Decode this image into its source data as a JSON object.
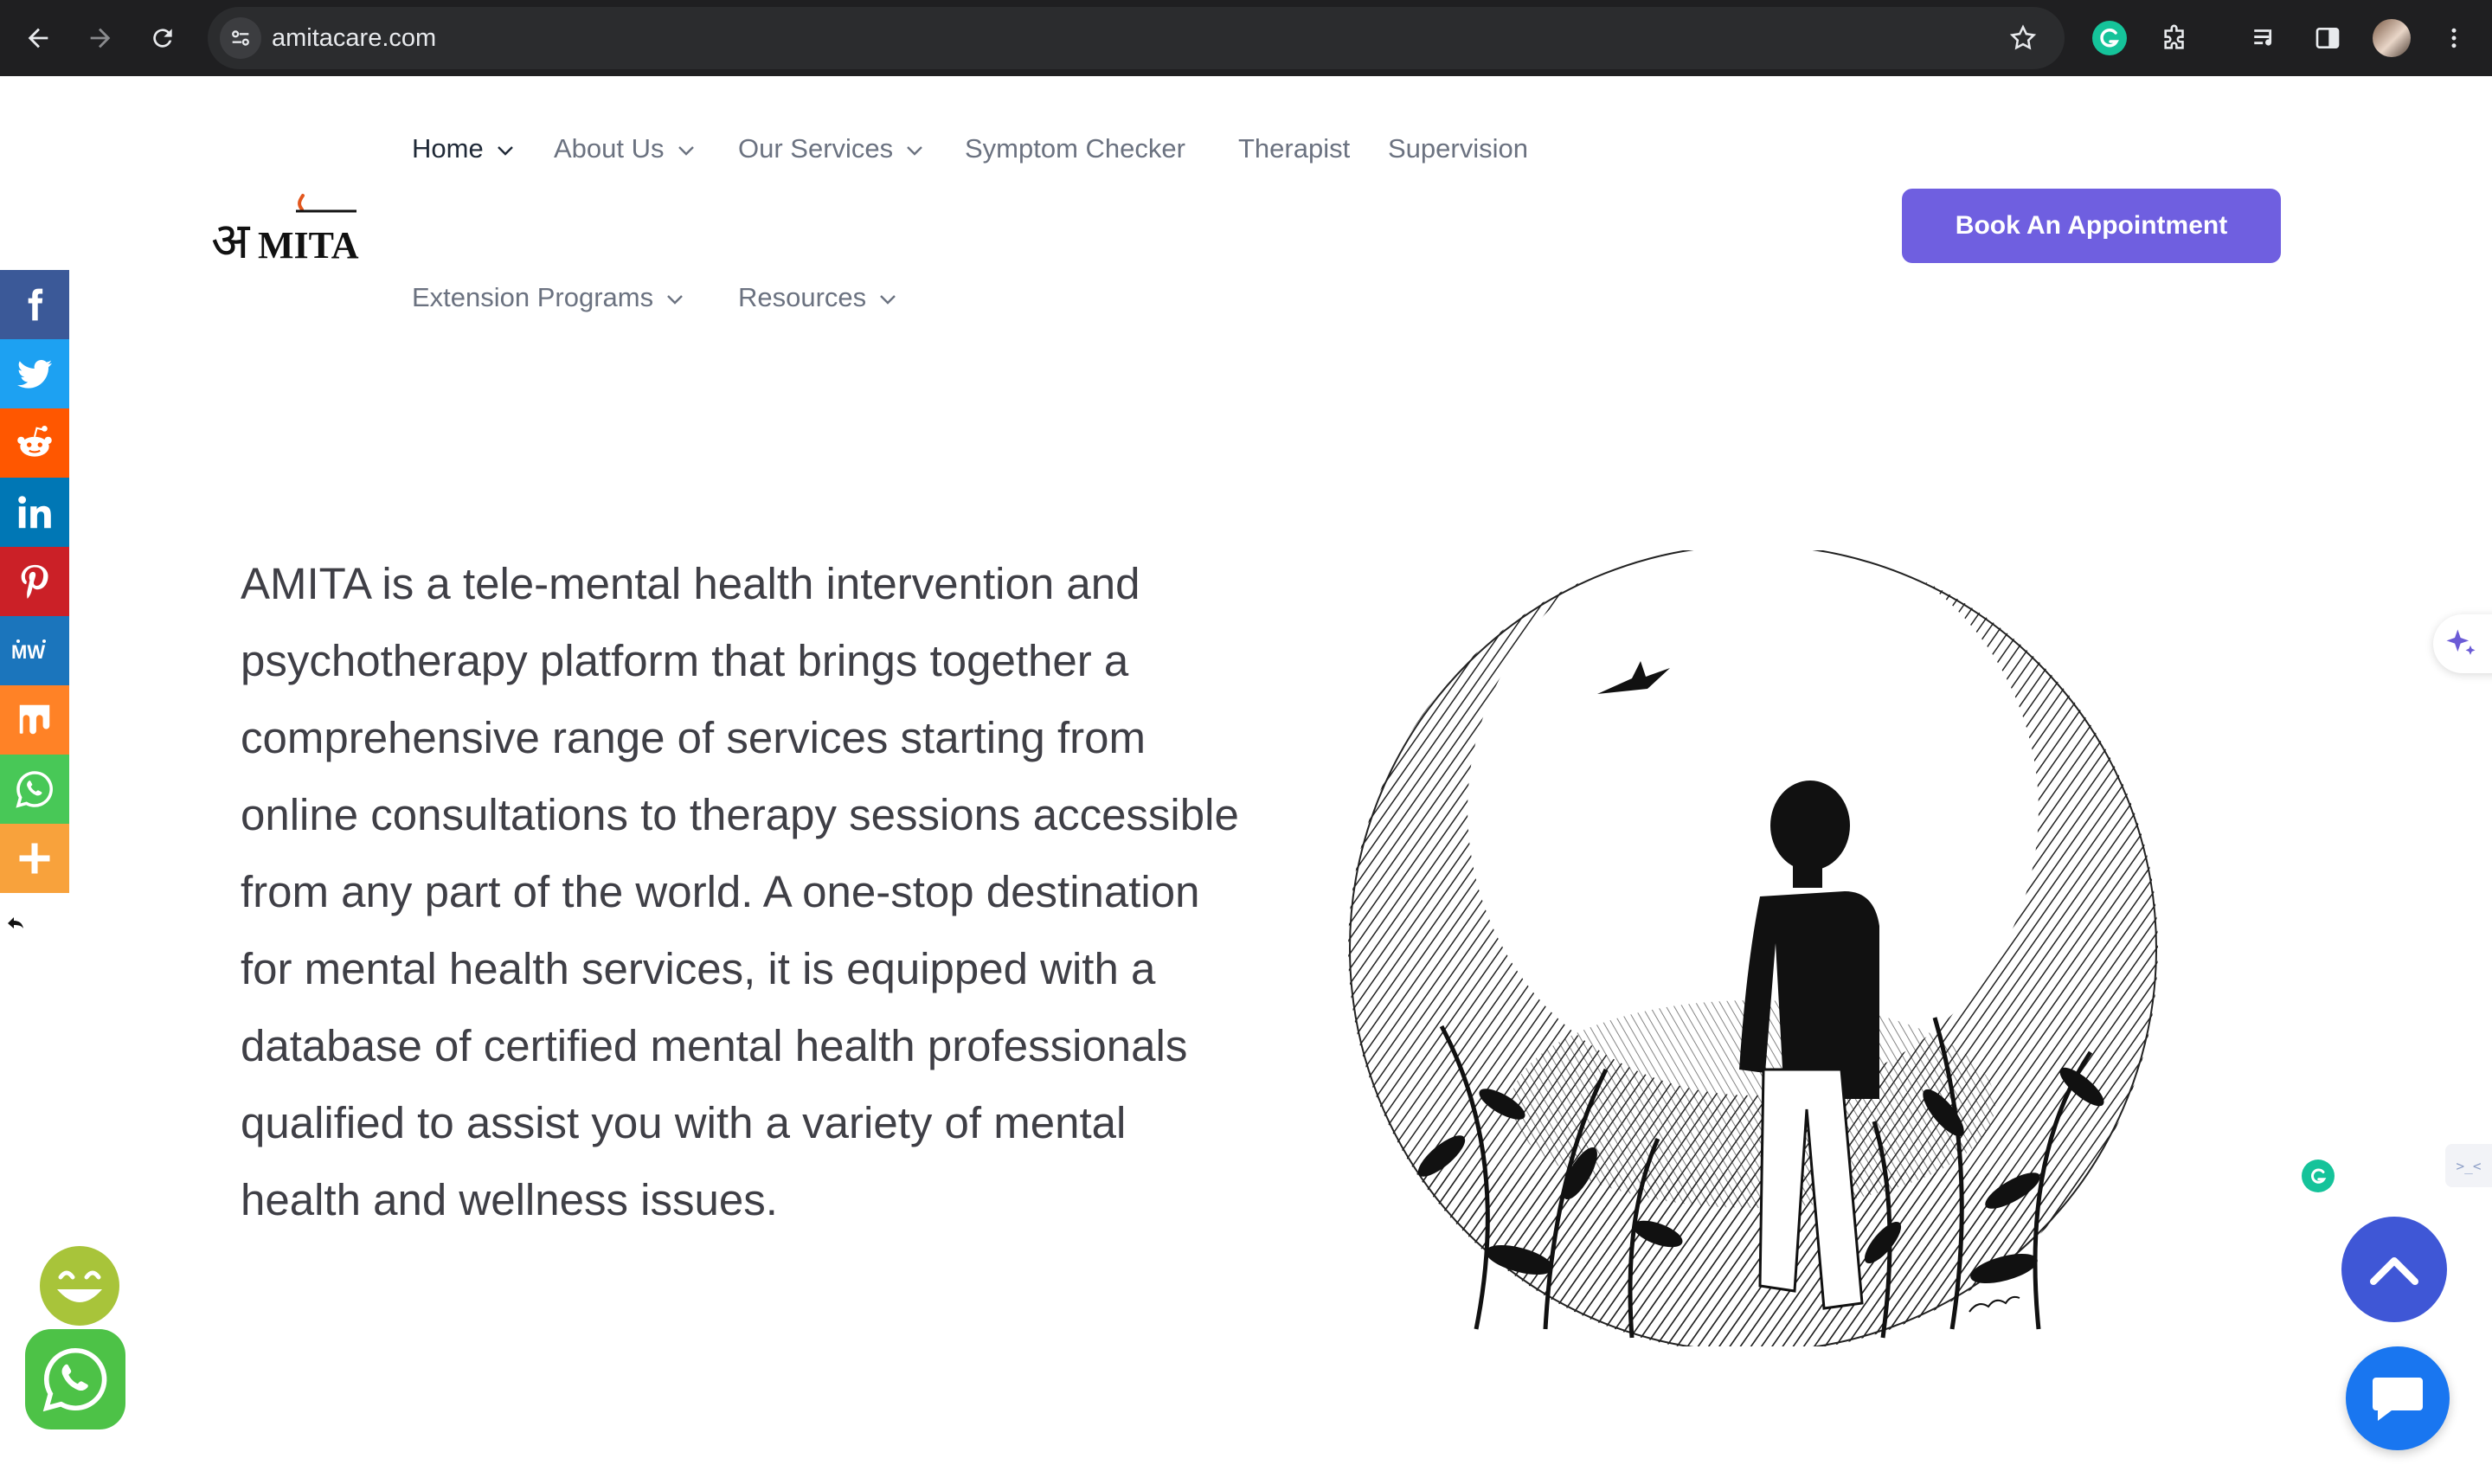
{
  "browser": {
    "url": "amitacare.com",
    "icons": [
      "back-icon",
      "forward-icon",
      "reload-icon",
      "site-settings-icon",
      "bookmark-star-icon",
      "grammarly-extension-icon",
      "extensions-puzzle-icon",
      "media-controls-icon",
      "side-panel-icon",
      "profile-avatar",
      "more-menu-icon"
    ]
  },
  "header": {
    "logo_alt": "AMITA",
    "nav": [
      {
        "label": "Home",
        "dropdown": true,
        "active": true
      },
      {
        "label": "About Us",
        "dropdown": true
      },
      {
        "label": "Our Services",
        "dropdown": true
      },
      {
        "label": "Symptom Checker",
        "dropdown": false
      },
      {
        "label": "Therapist",
        "dropdown": false
      },
      {
        "label": "Supervision",
        "dropdown": false
      },
      {
        "label": "Extension Programs",
        "dropdown": true
      },
      {
        "label": "Resources",
        "dropdown": true
      }
    ],
    "cta_label": "Book An Appointment",
    "accent_color": "#6f5fe0"
  },
  "share_bar": {
    "items": [
      {
        "name": "facebook",
        "color": "#3b5998"
      },
      {
        "name": "twitter",
        "color": "#1da1f2"
      },
      {
        "name": "reddit",
        "color": "#ff5700"
      },
      {
        "name": "linkedin",
        "color": "#0077b5"
      },
      {
        "name": "pinterest",
        "color": "#cb2027"
      },
      {
        "name": "mewe",
        "color": "#1b75bc"
      },
      {
        "name": "mix",
        "color": "#ff8226"
      },
      {
        "name": "whatsapp",
        "color": "#48c857"
      },
      {
        "name": "more",
        "color": "#f8a23c"
      }
    ]
  },
  "hero": {
    "text": "AMITA is a tele-mental health intervention and psychotherapy platform that brings together a comprehensive range of services starting from online consultations to therapy sessions accessible from any part of the world. A one-stop destination for mental health services, it is equipped with a database of certified mental health professionals qualified to assist you with a variety of mental health and wellness issues."
  },
  "widgets": {
    "side_box_text": ">_<",
    "scroll_top_color": "#3f57d6",
    "chat_color": "#1976f0",
    "whatsapp_color": "#4dc247"
  }
}
